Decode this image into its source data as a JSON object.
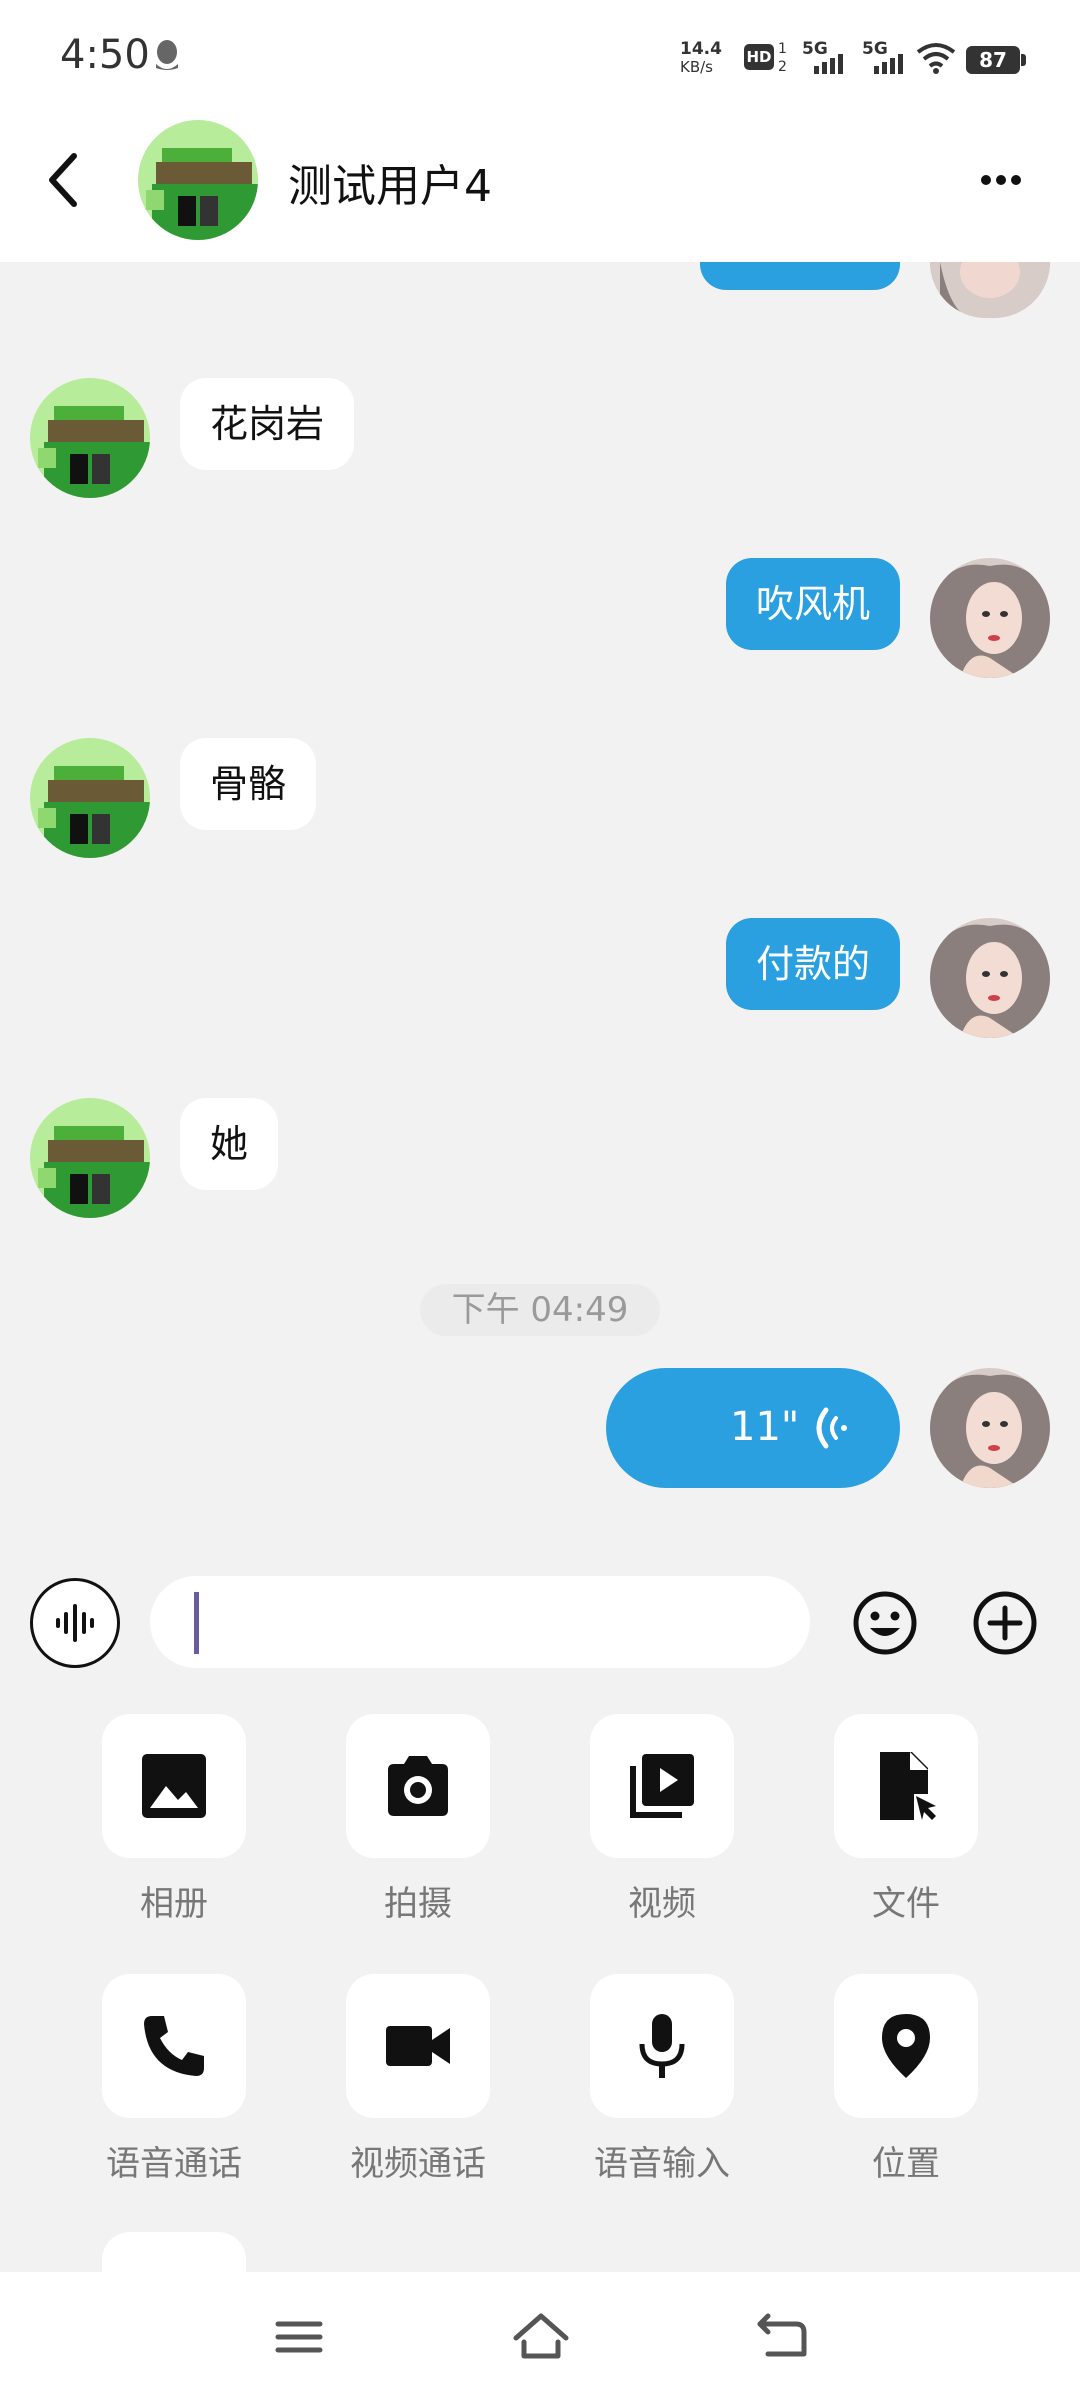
{
  "status_bar": {
    "time": "4:50",
    "net_speed_value": "14.4",
    "net_speed_unit": "KB/s",
    "hd_label": "HD",
    "hd_sub_top": "1",
    "hd_sub_bottom": "2",
    "signal1_label": "5G",
    "signal2_label": "5G",
    "battery": "87"
  },
  "header": {
    "title": "测试用户4"
  },
  "messages": [
    {
      "side": "in",
      "text": "花岗岩"
    },
    {
      "side": "out",
      "text": "吹风机"
    },
    {
      "side": "in",
      "text": "骨骼"
    },
    {
      "side": "out",
      "text": "付款的"
    },
    {
      "side": "in",
      "text": "她"
    }
  ],
  "time_separator": "下午 04:49",
  "voice_message": {
    "duration": "11\""
  },
  "input": {
    "value": "",
    "placeholder": ""
  },
  "tools": [
    {
      "label": "相册",
      "icon": "image-icon"
    },
    {
      "label": "拍摄",
      "icon": "camera-icon"
    },
    {
      "label": "视频",
      "icon": "video-library-icon"
    },
    {
      "label": "文件",
      "icon": "file-icon"
    },
    {
      "label": "语音通话",
      "icon": "phone-icon"
    },
    {
      "label": "视频通话",
      "icon": "videocam-icon"
    },
    {
      "label": "语音输入",
      "icon": "mic-icon"
    },
    {
      "label": "位置",
      "icon": "location-icon"
    }
  ],
  "colors": {
    "outgoing_bubble": "#2aa0e0",
    "incoming_bubble": "#ffffff",
    "background": "#f2f2f2"
  }
}
